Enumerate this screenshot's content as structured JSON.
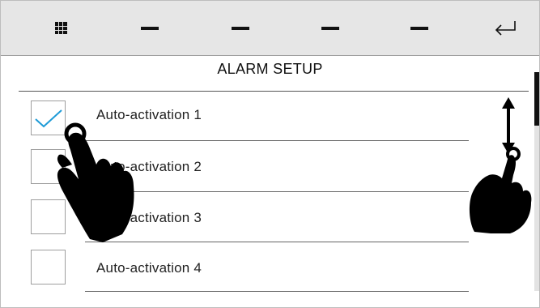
{
  "toolbar": {
    "menu_icon": "grid-icon",
    "back_icon": "return-arrow-icon",
    "slots": [
      "–",
      "–",
      "–",
      "–"
    ]
  },
  "header": {
    "title": "ALARM SETUP"
  },
  "alarm_list": {
    "items": [
      {
        "label": "Auto-activation 1",
        "checked": true
      },
      {
        "label": "Auto-activation 2",
        "checked": false
      },
      {
        "label": "Auto-activation 3",
        "checked": false
      },
      {
        "label": "Auto-activation 4",
        "checked": false
      }
    ]
  },
  "colors": {
    "check_accent": "#1e9bd7",
    "toolbar_bg": "#e6e6e6"
  },
  "gestures": {
    "tap_icon": "hand-tap-icon",
    "scroll_icon": "hand-swipe-vertical-icon"
  }
}
